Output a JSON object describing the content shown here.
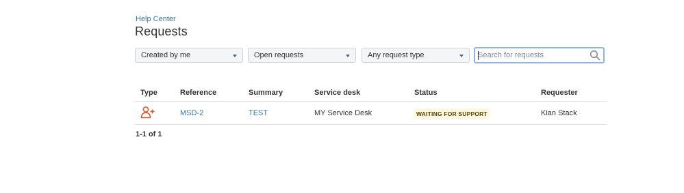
{
  "breadcrumb": {
    "label": "Help Center"
  },
  "page": {
    "title": "Requests"
  },
  "filters": {
    "created_by": {
      "selected": "Created by me"
    },
    "status": {
      "selected": "Open requests"
    },
    "request_type": {
      "selected": "Any request type"
    },
    "search": {
      "placeholder": "Search for requests",
      "value": ""
    }
  },
  "table": {
    "columns": [
      "Type",
      "Reference",
      "Summary",
      "Service desk",
      "Status",
      "Requester"
    ],
    "rows": [
      {
        "type_icon": "add-user-icon",
        "reference": "MSD-2",
        "summary": "TEST",
        "service_desk": "MY Service Desk",
        "status": "WAITING FOR SUPPORT",
        "requester": "Kian Stack"
      }
    ]
  },
  "pagination": {
    "label": "1-1 of 1"
  },
  "colors": {
    "link": "#3572b0",
    "status_bg": "#fff7e0",
    "status_text": "#594300",
    "type_icon": "#e8562a",
    "search_focus": "#8cb4e8"
  }
}
